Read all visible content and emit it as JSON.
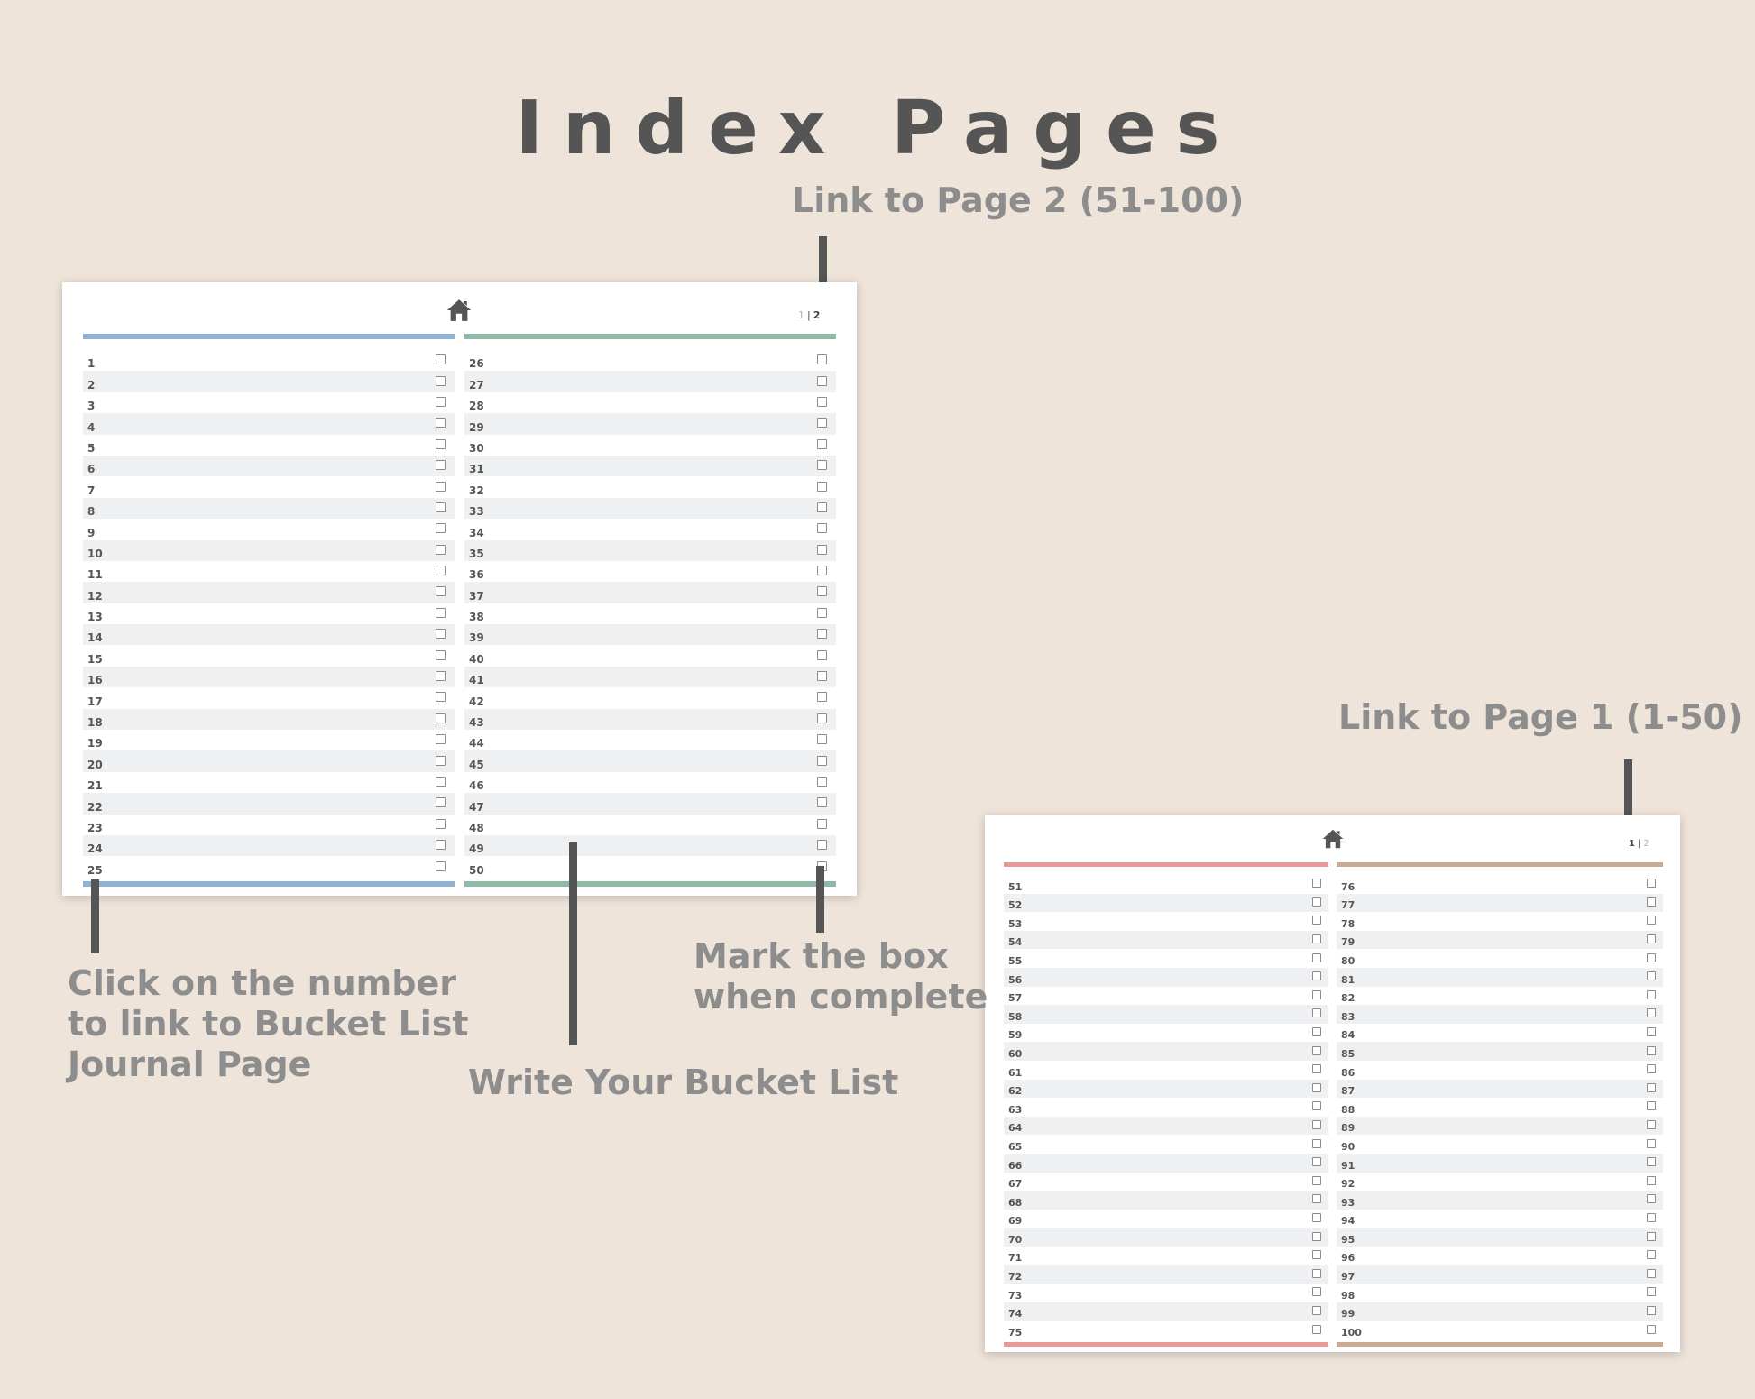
{
  "title": "Index Pages",
  "callouts": {
    "link_page2": "Link to Page 2 (51-100)",
    "link_page1": "Link to Page 1 (1-50)",
    "click_number": [
      "Click on the number",
      "to link to Bucket List",
      "Journal Page"
    ],
    "write_list": "Write Your Bucket List",
    "mark_box": [
      "Mark the box",
      "when complete"
    ]
  },
  "page1": {
    "home_icon": "home-icon",
    "pager": {
      "p1": "1",
      "sep": "|",
      "p2": "2",
      "current": "1"
    },
    "left_color": "#8fb3d6",
    "right_color": "#8dbba6",
    "left_numbers": [
      "1",
      "2",
      "3",
      "4",
      "5",
      "6",
      "7",
      "8",
      "9",
      "10",
      "11",
      "12",
      "13",
      "14",
      "15",
      "16",
      "17",
      "18",
      "19",
      "20",
      "21",
      "22",
      "23",
      "24",
      "25"
    ],
    "right_numbers": [
      "26",
      "27",
      "28",
      "29",
      "30",
      "31",
      "32",
      "33",
      "34",
      "35",
      "36",
      "37",
      "38",
      "39",
      "40",
      "41",
      "42",
      "43",
      "44",
      "45",
      "46",
      "47",
      "48",
      "49",
      "50"
    ]
  },
  "page2": {
    "home_icon": "home-icon",
    "pager": {
      "p1": "1",
      "sep": "|",
      "p2": "2",
      "current": "2"
    },
    "left_color": "#e99a98",
    "right_color": "#c9ab93",
    "left_numbers": [
      "51",
      "52",
      "53",
      "54",
      "55",
      "56",
      "57",
      "58",
      "59",
      "60",
      "61",
      "62",
      "63",
      "64",
      "65",
      "66",
      "67",
      "68",
      "69",
      "70",
      "71",
      "72",
      "73",
      "74",
      "75"
    ],
    "right_numbers": [
      "76",
      "77",
      "78",
      "79",
      "80",
      "81",
      "82",
      "83",
      "84",
      "85",
      "86",
      "87",
      "88",
      "89",
      "90",
      "91",
      "92",
      "93",
      "94",
      "95",
      "96",
      "97",
      "98",
      "99",
      "100"
    ]
  }
}
